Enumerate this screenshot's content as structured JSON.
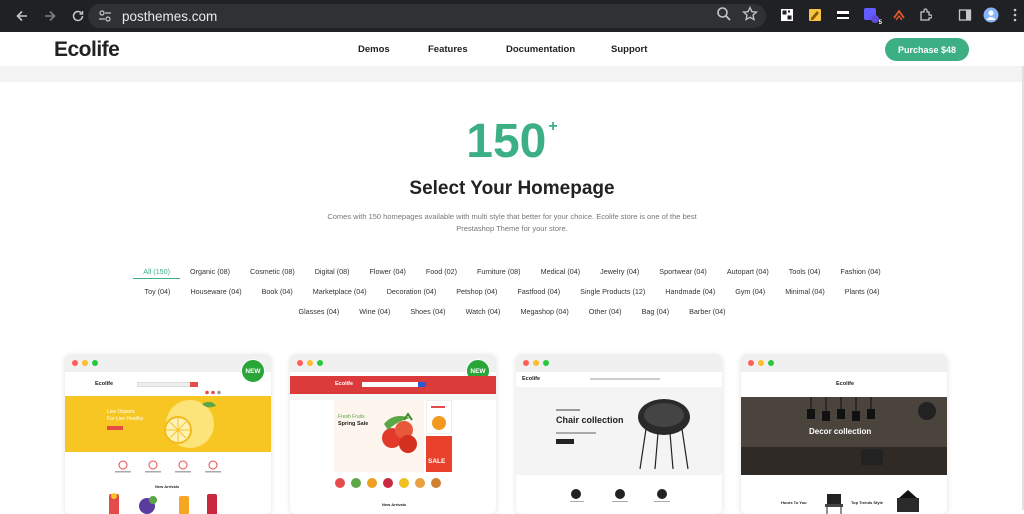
{
  "browser": {
    "url": "posthemes.com",
    "extension_badge": "5"
  },
  "header": {
    "logo": "Ecolife",
    "menu": [
      "Demos",
      "Features",
      "Documentation",
      "Support"
    ],
    "purchase_label": "Purchase $48"
  },
  "hero": {
    "count": "150",
    "count_suffix": "+",
    "heading": "Select Your Homepage",
    "description_line1": "Comes with 150 homepages available with multi style that better for your choice. Ecolife store is one of the best",
    "description_line2": "Prestashop Theme for your store."
  },
  "filters": {
    "row1": [
      "All (150)",
      "Organic (08)",
      "Cosmetic (08)",
      "Digital (08)",
      "Flower (04)",
      "Food (02)",
      "Furniture (08)",
      "Medical (04)",
      "Jewelry (04)",
      "Sportwear (04)",
      "Autopart (04)",
      "Tools (04)",
      "Fashion (04)"
    ],
    "row2": [
      "Toy (04)",
      "Houseware (04)",
      "Book (04)",
      "Marketplace (04)",
      "Decoration (04)",
      "Petshop (04)",
      "Fastfood (04)",
      "Single Products (12)",
      "Handmade (04)",
      "Gym (04)",
      "Minimal (04)",
      "Plants (04)"
    ],
    "row3": [
      "Glasses (04)",
      "Wine (04)",
      "Shoes (04)",
      "Watch (04)",
      "Megashop (04)",
      "Other (04)",
      "Bag (04)",
      "Barber (04)"
    ],
    "active": "All (150)"
  },
  "cards": [
    {
      "badge": "NEW",
      "logo": "Ecolife",
      "banner_title": "Live Organic",
      "banner_sub": "For Live Healthy",
      "section": "New Arrivals"
    },
    {
      "badge": "NEW",
      "logo": "Ecolife",
      "banner_title": "Fresh Fruits",
      "banner_sub": "Spring Sale",
      "section": "New Arrivals",
      "sale": "SALE"
    },
    {
      "logo": "Ecolife",
      "banner_title": "Chair collection"
    },
    {
      "logo": "Ecolife",
      "banner_title": "Decor collection",
      "section1": "Hours To You",
      "section2": "Top Trends Style"
    }
  ],
  "colors": {
    "brand": "#3daf85",
    "badge": "#2aa537",
    "chrome": "#202124"
  }
}
